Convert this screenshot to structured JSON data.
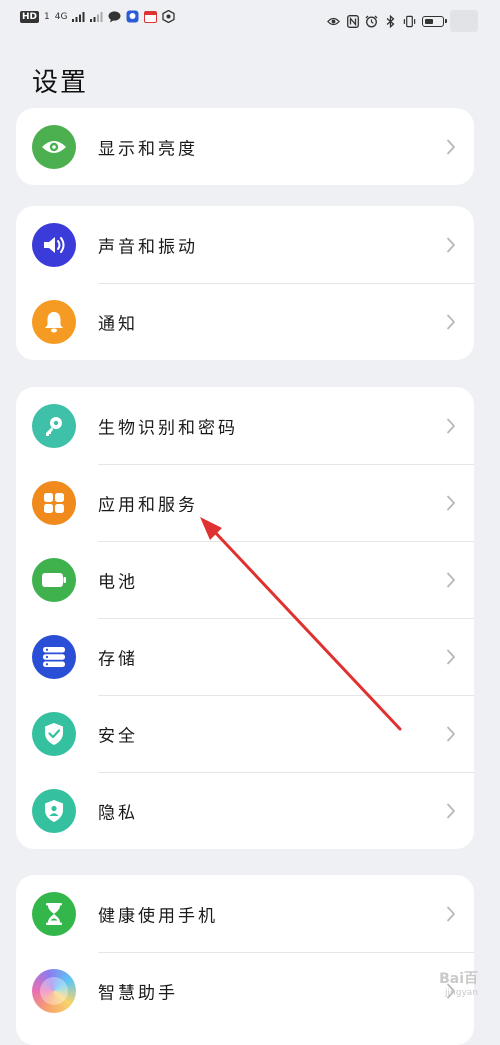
{
  "status_bar": {
    "hd": "HD",
    "sim": "1",
    "network": "4G",
    "icons_left": [
      "signal-icon",
      "signal-alt-icon",
      "chat-bubble-icon",
      "app-notification-icon",
      "calendar-icon",
      "location-icon"
    ],
    "icons_right": [
      "eye-comfort-icon",
      "nfc-icon",
      "alarm-icon",
      "bluetooth-icon",
      "vibrate-icon",
      "battery-icon"
    ]
  },
  "page": {
    "title": "设置"
  },
  "groups": [
    [
      {
        "label": "显示和亮度",
        "icon": "eye-icon",
        "color": "#4caf50"
      }
    ],
    [
      {
        "label": "声音和振动",
        "icon": "speaker-icon",
        "color": "#3b3bd9"
      },
      {
        "label": "通知",
        "icon": "bell-icon",
        "color": "#f59a22"
      }
    ],
    [
      {
        "label": "生物识别和密码",
        "icon": "key-icon",
        "color": "#3ec1a8"
      },
      {
        "label": "应用和服务",
        "icon": "apps-grid-icon",
        "color": "#f08a1c"
      },
      {
        "label": "电池",
        "icon": "battery-icon",
        "color": "#3fb24d"
      },
      {
        "label": "存储",
        "icon": "storage-icon",
        "color": "#2a4fd6"
      },
      {
        "label": "安全",
        "icon": "shield-check-icon",
        "color": "#35c0a0"
      },
      {
        "label": "隐私",
        "icon": "privacy-shield-icon",
        "color": "#35c0a0"
      }
    ],
    [
      {
        "label": "健康使用手机",
        "icon": "hourglass-icon",
        "color": "#33b64a"
      },
      {
        "label": "智慧助手",
        "icon": "assistant-orb-icon",
        "color": "#c78be8"
      }
    ]
  ],
  "annotation": {
    "arrow_color": "#e03131",
    "target": "应用和服务"
  },
  "watermark": {
    "text": "Bai百",
    "subtext": "jingyan"
  }
}
